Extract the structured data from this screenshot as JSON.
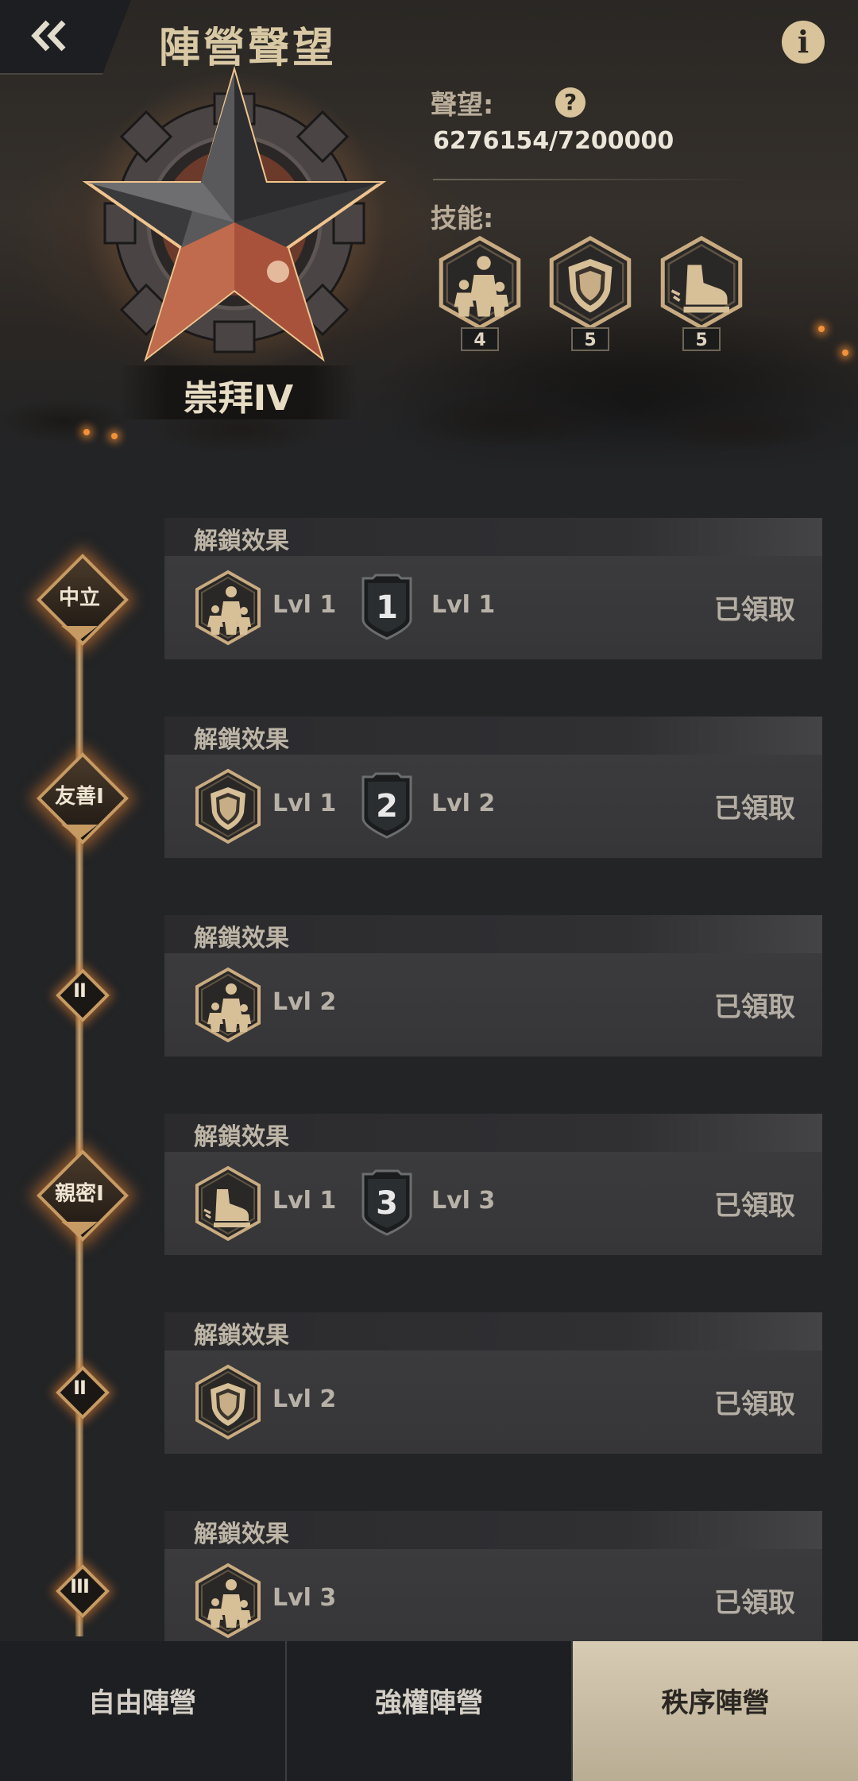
{
  "header": {
    "title": "陣營聲望",
    "rank_name": "崇拜IV",
    "reputation_label": "聲望:",
    "reputation_value": "6276154/7200000",
    "skills_label": "技能:",
    "skills": [
      {
        "icon": "troops-icon",
        "count": "4"
      },
      {
        "icon": "shield-icon",
        "count": "5"
      },
      {
        "icon": "boot-icon",
        "count": "5"
      }
    ]
  },
  "timeline": [
    {
      "node": "中立",
      "node_style": "big",
      "title": "解鎖效果",
      "rewards": [
        {
          "icon": "troops-icon",
          "level": "Lvl 1"
        },
        {
          "icon": "rank-badge-1-icon",
          "badge": "1",
          "level": "Lvl 1"
        }
      ],
      "status": "已領取"
    },
    {
      "node": "友善I",
      "node_style": "big",
      "title": "解鎖效果",
      "rewards": [
        {
          "icon": "shield-icon",
          "level": "Lvl 1"
        },
        {
          "icon": "rank-badge-2-icon",
          "badge": "2",
          "level": "Lvl 2"
        }
      ],
      "status": "已領取"
    },
    {
      "node": "II",
      "node_style": "small",
      "title": "解鎖效果",
      "rewards": [
        {
          "icon": "troops-icon",
          "level": "Lvl 2"
        }
      ],
      "status": "已領取"
    },
    {
      "node": "親密I",
      "node_style": "big",
      "title": "解鎖效果",
      "rewards": [
        {
          "icon": "boot-icon",
          "level": "Lvl 1"
        },
        {
          "icon": "rank-badge-3-icon",
          "badge": "3",
          "level": "Lvl 3"
        }
      ],
      "status": "已領取"
    },
    {
      "node": "II",
      "node_style": "small",
      "title": "解鎖效果",
      "rewards": [
        {
          "icon": "shield-icon",
          "level": "Lvl 2"
        }
      ],
      "status": "已領取"
    },
    {
      "node": "III",
      "node_style": "small",
      "title": "解鎖效果",
      "rewards": [
        {
          "icon": "troops-icon",
          "level": "Lvl 3"
        }
      ],
      "status": "已領取"
    }
  ],
  "tabs": [
    {
      "label": "自由陣營",
      "active": false
    },
    {
      "label": "強權陣營",
      "active": false
    },
    {
      "label": "秩序陣營",
      "active": true
    }
  ],
  "colors": {
    "accent_gold": "#c69a63",
    "glow": "#f2913a",
    "active_tab": "#d6cbb3"
  }
}
